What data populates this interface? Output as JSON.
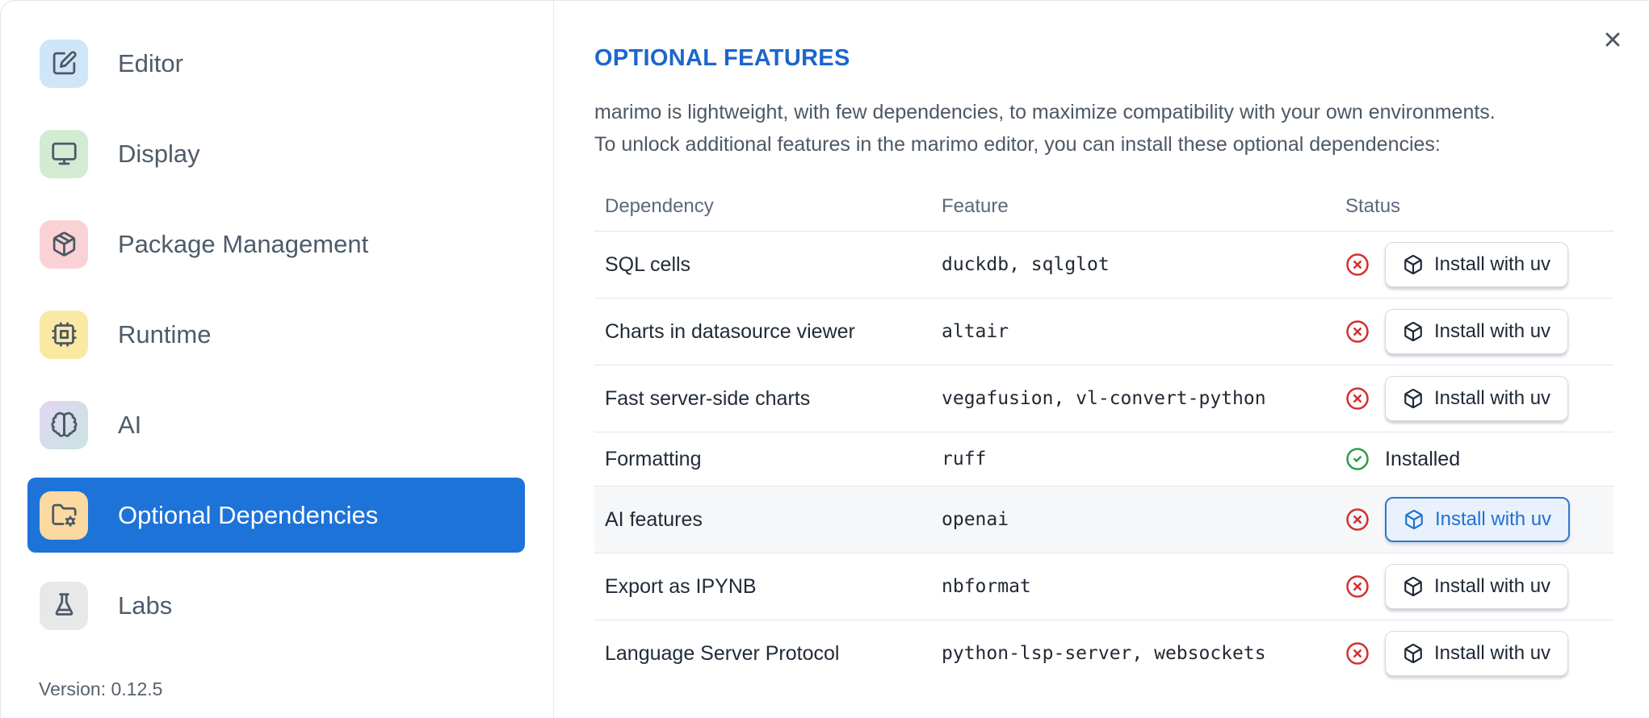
{
  "sidebar": {
    "items": [
      {
        "label": "Editor",
        "icon": "square-pen-icon",
        "selected": false
      },
      {
        "label": "Display",
        "icon": "monitor-icon",
        "selected": false
      },
      {
        "label": "Package Management",
        "icon": "package-icon",
        "selected": false
      },
      {
        "label": "Runtime",
        "icon": "cpu-icon",
        "selected": false
      },
      {
        "label": "AI",
        "icon": "brain-icon",
        "selected": false
      },
      {
        "label": "Optional Dependencies",
        "icon": "folder-cog-icon",
        "selected": true
      },
      {
        "label": "Labs",
        "icon": "flask-icon",
        "selected": false
      }
    ],
    "version": "Version: 0.12.5"
  },
  "main": {
    "title": "OPTIONAL FEATURES",
    "description_lines": [
      "marimo is lightweight, with few dependencies, to maximize compatibility with your own environments.",
      "To unlock additional features in the marimo editor, you can install these optional dependencies:"
    ],
    "table": {
      "columns": {
        "dependency": "Dependency",
        "feature": "Feature",
        "status": "Status"
      },
      "rows": [
        {
          "dependency": "SQL cells",
          "feature": "duckdb, sqlglot",
          "installed": false,
          "action": "Install with uv",
          "highlighted": false
        },
        {
          "dependency": "Charts in datasource viewer",
          "feature": "altair",
          "installed": false,
          "action": "Install with uv",
          "highlighted": false
        },
        {
          "dependency": "Fast server-side charts",
          "feature": "vegafusion, vl-convert-python",
          "installed": false,
          "action": "Install with uv",
          "highlighted": false
        },
        {
          "dependency": "Formatting",
          "feature": "ruff",
          "installed": true,
          "status_text": "Installed",
          "highlighted": false
        },
        {
          "dependency": "AI features",
          "feature": "openai",
          "installed": false,
          "action": "Install with uv",
          "highlighted": true
        },
        {
          "dependency": "Export as IPYNB",
          "feature": "nbformat",
          "installed": false,
          "action": "Install with uv",
          "highlighted": false
        },
        {
          "dependency": "Language Server Protocol",
          "feature": "python-lsp-server, websockets",
          "installed": false,
          "action": "Install with uv",
          "highlighted": false
        }
      ]
    }
  },
  "colors": {
    "accent_blue": "#1e73d8",
    "title_blue": "#1c66cc",
    "error_red": "#d23030",
    "success_green": "#2d9d44",
    "focus_button_bg": "#e8f1fc",
    "focus_button_border": "#2c78d6"
  }
}
